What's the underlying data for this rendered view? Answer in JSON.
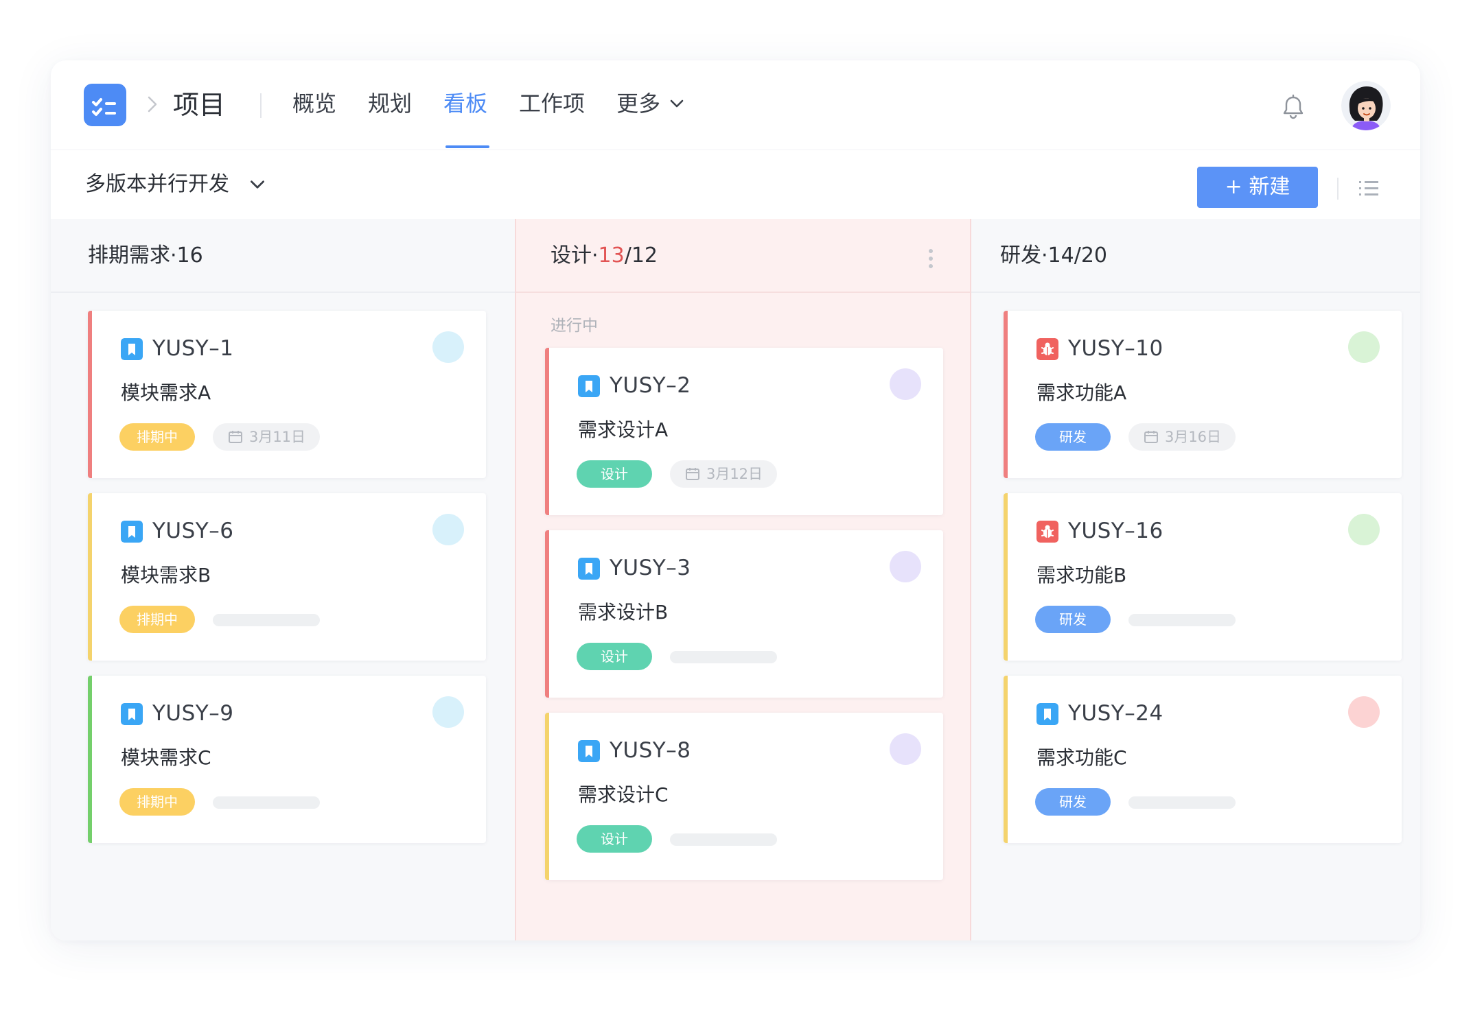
{
  "nav": {
    "project": "项目",
    "tabs": [
      "概览",
      "规划",
      "看板",
      "工作项"
    ],
    "more": "更多",
    "active_tab": "看板"
  },
  "toolbar": {
    "version_select": "多版本并行开发",
    "new_button": "+ 新建"
  },
  "columns": [
    {
      "title": "排期需求",
      "count": "16",
      "cards": [
        {
          "id": "YUSY–1",
          "name": "模块需求A",
          "tag": "排期中",
          "date": "3月11日"
        },
        {
          "id": "YUSY–6",
          "name": "模块需求B",
          "tag": "排期中"
        },
        {
          "id": "YUSY–9",
          "name": "模块需求C",
          "tag": "排期中"
        }
      ]
    },
    {
      "title": "设计",
      "count_current": "13",
      "count_limit": "/12",
      "group": "进行中",
      "cards": [
        {
          "id": "YUSY–2",
          "name": "需求设计A",
          "tag": "设计",
          "date": "3月12日"
        },
        {
          "id": "YUSY–3",
          "name": "需求设计B",
          "tag": "设计"
        },
        {
          "id": "YUSY–8",
          "name": "需求设计C",
          "tag": "设计"
        }
      ]
    },
    {
      "title": "研发",
      "count": "14/20",
      "cards": [
        {
          "id": "YUSY–10",
          "name": "需求功能A",
          "tag": "研发",
          "date": "3月16日"
        },
        {
          "id": "YUSY–16",
          "name": "需求功能B",
          "tag": "研发"
        },
        {
          "id": "YUSY–24",
          "name": "需求功能C",
          "tag": "研发"
        }
      ]
    }
  ],
  "colors": {
    "accent": "#4d8bf5",
    "tag_scheduling": "#fcd062",
    "tag_design": "#5fd3b0",
    "tag_dev": "#6aa4f7",
    "wip_exceeded": "#e25454"
  },
  "icons": {
    "logo": "task-folder-icon",
    "requirement": "bookmark-icon",
    "bug": "bug-icon"
  }
}
